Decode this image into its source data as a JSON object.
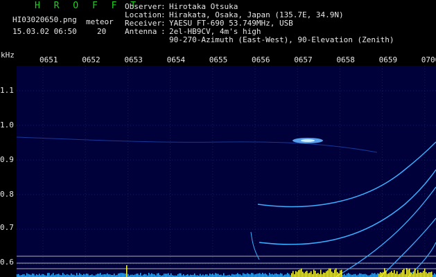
{
  "header": {
    "logo": "H R O F F T",
    "filename": "HI03020650.png",
    "datetime": "15.03.02 06:50",
    "meteor_label": "meteor",
    "meteor_count": "20"
  },
  "meta": [
    {
      "key": "Observer",
      "sep": ":",
      "value": "Hirotaka Otsuka"
    },
    {
      "key": "Location",
      "sep": ":",
      "value": "Hirakata, Osaka, Japan (135.7E, 34.9N)"
    },
    {
      "key": "Receiver",
      "sep": ":",
      "value": "YAESU FT-690 53.749MHz, USB"
    },
    {
      "key": "Antenna",
      "sep": ":",
      "value": "2el-HB9CV, 4m's high"
    },
    {
      "key": "",
      "sep": "",
      "value": "90-270-Azimuth (East-West), 90-Elevation (Zenith)"
    }
  ],
  "axis": {
    "y_unit": "kHz",
    "x_ticks": [
      "0651",
      "0652",
      "0653",
      "0654",
      "0655",
      "0656",
      "0657",
      "0658",
      "0659",
      "0700"
    ],
    "y_ticks": [
      "1.1",
      "1.0",
      "0.9",
      "0.8",
      "0.7",
      "0.6"
    ]
  },
  "colors": {
    "background": "#000000",
    "plot_bg": "#00003a",
    "text": "#e8e8e8",
    "logo": "#20d020",
    "trace": "#3ab0ff",
    "noise": "#ffff40"
  }
}
